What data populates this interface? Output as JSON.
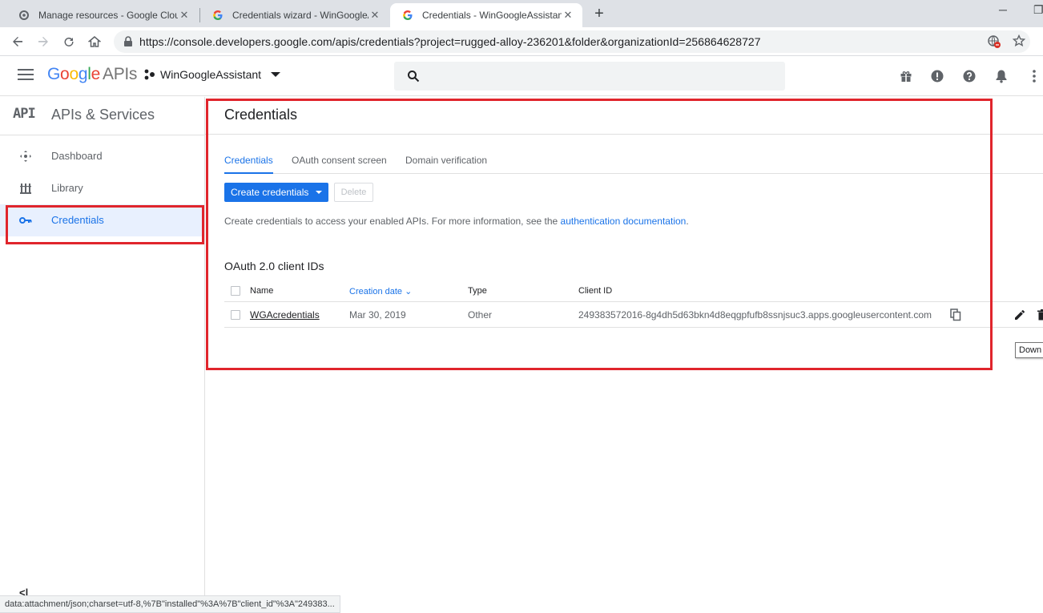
{
  "browser": {
    "tabs": [
      {
        "title": "Manage resources - Google Clou",
        "active": false
      },
      {
        "title": "Credentials wizard - WinGoogleA",
        "active": false
      },
      {
        "title": "Credentials - WinGoogleAssistan",
        "active": true
      }
    ],
    "url": "https://console.developers.google.com/apis/credentials?project=rugged-alloy-236201&folder&organizationId=256864628727",
    "status_text": "data:attachment/json;charset=utf-8,%7B\"installed\"%3A%7B\"client_id\"%3A\"249383..."
  },
  "header": {
    "logo_google": [
      "G",
      "o",
      "o",
      "g",
      "l",
      "e"
    ],
    "logo_apis": "APIs",
    "project_name": "WinGoogleAssistant",
    "search_placeholder": ""
  },
  "sidebar": {
    "badge": "API",
    "title": "APIs & Services",
    "items": [
      {
        "label": "Dashboard",
        "icon": "dashboard-icon",
        "active": false
      },
      {
        "label": "Library",
        "icon": "library-icon",
        "active": false
      },
      {
        "label": "Credentials",
        "icon": "key-icon",
        "active": true
      }
    ],
    "collapse_label": "<|"
  },
  "main": {
    "title": "Credentials",
    "tabs": [
      "Credentials",
      "OAuth consent screen",
      "Domain verification"
    ],
    "create_button": "Create credentials",
    "delete_button": "Delete",
    "info_text": "Create credentials to access your enabled APIs. For more information, see the ",
    "info_link": "authentication documentation",
    "info_end": ".",
    "section_title": "OAuth 2.0 client IDs",
    "table": {
      "headers": [
        "Name",
        "Creation date",
        "Type",
        "Client ID"
      ],
      "sort_indicator": "⌄",
      "rows": [
        {
          "name": "WGAcredentials",
          "creation_date": "Mar 30, 2019",
          "type": "Other",
          "client_id": "249383572016-8g4dh5d63bkn4d8eqgpfufb8ssnjsuc3.apps.googleusercontent.com"
        }
      ]
    },
    "tooltip": "Down"
  },
  "colors": {
    "accent": "#1a73e8",
    "highlight": "#e0252c"
  }
}
